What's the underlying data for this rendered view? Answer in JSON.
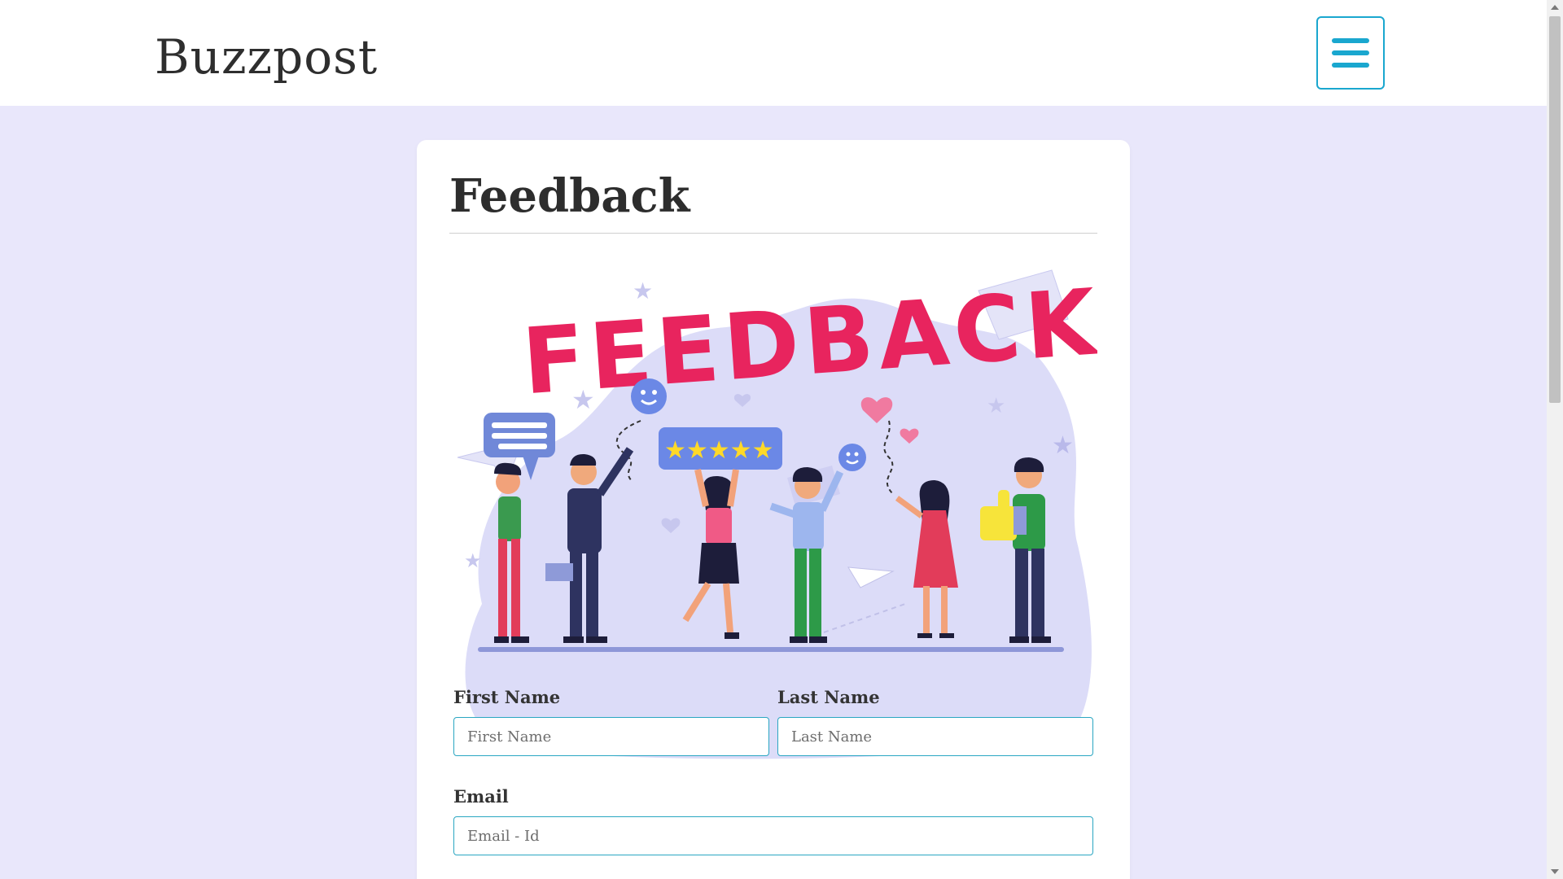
{
  "navbar": {
    "brand": "Buzzpost",
    "menu_icon": "hamburger-menu-icon"
  },
  "card": {
    "title": "Feedback",
    "illustration": {
      "alt_icon": "feedback-illustration",
      "headline": "FEEDBACK",
      "star_rating": 5
    }
  },
  "form": {
    "first_name": {
      "label": "First Name",
      "placeholder": "First Name",
      "value": ""
    },
    "last_name": {
      "label": "Last Name",
      "placeholder": "Last Name",
      "value": ""
    },
    "email": {
      "label": "Email",
      "placeholder": "Email - Id",
      "value": ""
    }
  },
  "colors": {
    "accent": "#1aa7cf",
    "page_background": "#e9e7fb",
    "headline_pink": "#e8245e",
    "illustration_blob": "#dcdcf8"
  }
}
